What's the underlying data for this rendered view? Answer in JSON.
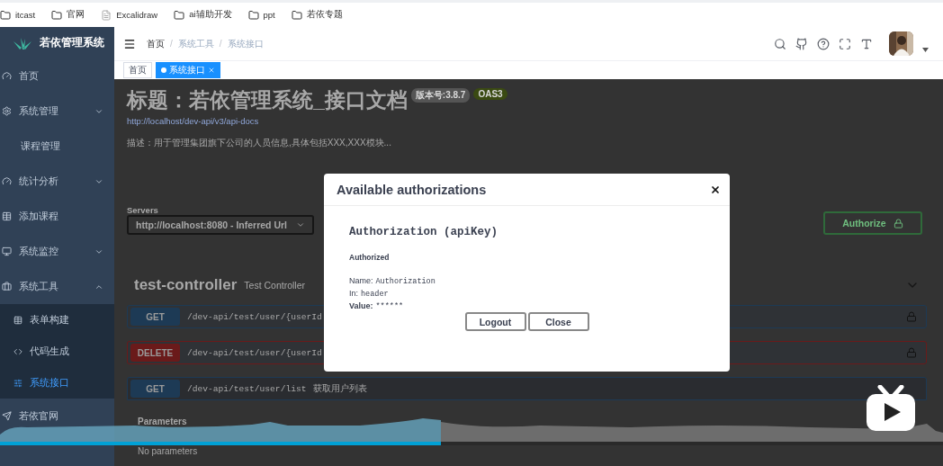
{
  "bookmarks": [
    {
      "label": "itcast",
      "kind": "folder"
    },
    {
      "label": "官网",
      "kind": "folder"
    },
    {
      "label": "Excalidraw",
      "kind": "page"
    },
    {
      "label": "ai辅助开发",
      "kind": "folder"
    },
    {
      "label": "ppt",
      "kind": "folder"
    },
    {
      "label": "若依专题",
      "kind": "folder"
    }
  ],
  "sidebar": {
    "title": "若依管理系统",
    "items": [
      {
        "label": "首页",
        "selected": false
      },
      {
        "label": "系统管理",
        "selected": false,
        "expanded": false
      },
      {
        "label": "课程管理",
        "selected": false
      },
      {
        "label": "统计分析",
        "selected": false,
        "expanded": false
      },
      {
        "label": "添加课程",
        "selected": false
      },
      {
        "label": "系统监控",
        "selected": false,
        "expanded": false
      },
      {
        "label": "系统工具",
        "selected": false,
        "expanded": true,
        "children": [
          {
            "label": "表单构建",
            "selected": false
          },
          {
            "label": "代码生成",
            "selected": false
          },
          {
            "label": "系统接口",
            "selected": true
          }
        ]
      },
      {
        "label": "若依官网",
        "selected": false
      }
    ]
  },
  "breadcrumb": {
    "separator": "/",
    "items": [
      "首页",
      "系统工具",
      "系统接口"
    ]
  },
  "tags": [
    {
      "label": "首页",
      "selected": false
    },
    {
      "label": "系统接口",
      "selected": true
    }
  ],
  "api_doc": {
    "title": "标题：若依管理系统_接口文档",
    "version_badge": "版本号:3.8.7",
    "oas_badge": "OAS3",
    "url": "http://localhost/dev-api/v3/api-docs",
    "description": "描述：用于管理集团旗下公司的人员信息,具体包括XXX,XXX模块...",
    "servers_label": "Servers",
    "server_select": "http://localhost:8080 - Inferred Url",
    "authorize_button": "Authorize",
    "section": {
      "name": "test-controller",
      "description": "Test Controller",
      "expanded": true,
      "operations": [
        {
          "method": "GET",
          "color": "#1d3a55",
          "path": "/dev-api/test/user/{userId",
          "locked": true,
          "expanded": false
        },
        {
          "method": "DELETE",
          "color": "#6a1a1a",
          "path": "/dev-api/test/user/{userId",
          "locked": true,
          "expanded": false
        },
        {
          "method": "GET",
          "color": "#1d3a55",
          "path": "/dev-api/test/user/list",
          "summary": "获取用户列表",
          "locked": false,
          "expanded": true
        }
      ]
    },
    "parameters_label": "Parameters",
    "no_parameters": "No parameters"
  },
  "modal": {
    "title": "Available authorizations",
    "scheme": "Authorization (apiKey)",
    "status": "Authorized",
    "name_label": "Name:",
    "name_value": "Authorization",
    "in_label": "In:",
    "in_value": "header",
    "value_label": "Value:",
    "value": "******",
    "buttons": [
      "Logout",
      "Close"
    ]
  },
  "player": {
    "progress": {
      "level": 0.468
    }
  }
}
